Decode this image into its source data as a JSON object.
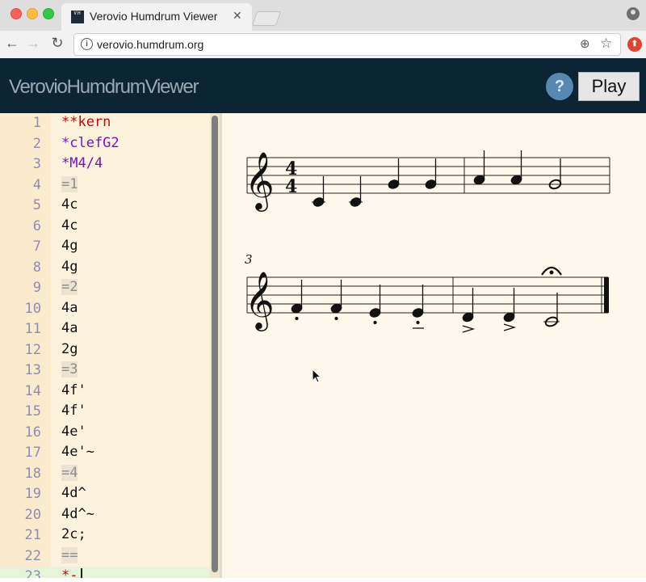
{
  "browser": {
    "tab_title": "Verovio Humdrum Viewer",
    "tab_favicon": "VH",
    "url": "verovio.humdrum.org"
  },
  "app": {
    "title": "VerovioHumdrumViewer",
    "help_label": "?",
    "play_label": "Play"
  },
  "editor": {
    "lines": [
      {
        "num": "1",
        "text": "**kern",
        "style": "red"
      },
      {
        "num": "2",
        "text": "*clefG2",
        "style": "purple"
      },
      {
        "num": "3",
        "text": "*M4/4",
        "style": "purple"
      },
      {
        "num": "4",
        "text": "=1",
        "style": "bar"
      },
      {
        "num": "5",
        "text": "4c",
        "style": "plain"
      },
      {
        "num": "6",
        "text": "4c",
        "style": "plain"
      },
      {
        "num": "7",
        "text": "4g",
        "style": "plain"
      },
      {
        "num": "8",
        "text": "4g",
        "style": "plain"
      },
      {
        "num": "9",
        "text": "=2",
        "style": "bar"
      },
      {
        "num": "10",
        "text": "4a",
        "style": "plain"
      },
      {
        "num": "11",
        "text": "4a",
        "style": "plain"
      },
      {
        "num": "12",
        "text": "2g",
        "style": "plain"
      },
      {
        "num": "13",
        "text": "=3",
        "style": "bar"
      },
      {
        "num": "14",
        "text": "4f'",
        "style": "plain"
      },
      {
        "num": "15",
        "text": "4f'",
        "style": "plain"
      },
      {
        "num": "16",
        "text": "4e'",
        "style": "plain"
      },
      {
        "num": "17",
        "text": "4e'~",
        "style": "plain"
      },
      {
        "num": "18",
        "text": "=4",
        "style": "bar"
      },
      {
        "num": "19",
        "text": "4d^",
        "style": "plain"
      },
      {
        "num": "20",
        "text": "4d^~",
        "style": "plain"
      },
      {
        "num": "21",
        "text": "2c;",
        "style": "plain"
      },
      {
        "num": "22",
        "text": "==",
        "style": "bar"
      },
      {
        "num": "23",
        "text": "*-",
        "style": "red"
      }
    ]
  },
  "score": {
    "system2_measure_number": "3",
    "time_signature_top": "4",
    "time_signature_bottom": "4"
  }
}
